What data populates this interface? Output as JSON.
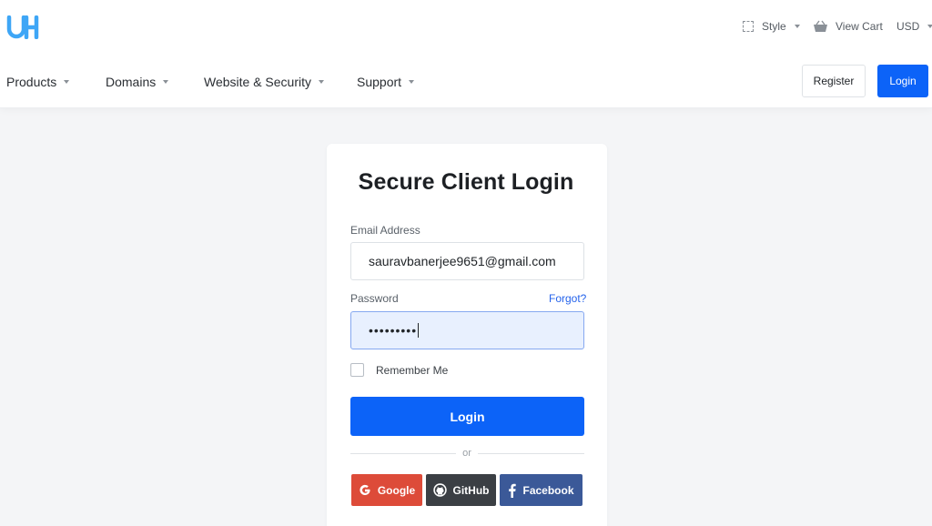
{
  "topbar": {
    "style_label": "Style",
    "cart_label": "View Cart",
    "currency_label": "USD"
  },
  "nav": {
    "items": [
      {
        "label": "Products"
      },
      {
        "label": "Domains"
      },
      {
        "label": "Website & Security"
      },
      {
        "label": "Support"
      }
    ],
    "register_label": "Register",
    "login_label": "Login"
  },
  "login_card": {
    "title": "Secure Client Login",
    "email_label": "Email Address",
    "email_value": "sauravbanerjee9651@gmail.com",
    "password_label": "Password",
    "forgot_label": "Forgot?",
    "password_mask": "•••••••••",
    "remember_label": "Remember Me",
    "submit_label": "Login",
    "or_label": "or",
    "social": {
      "google": "Google",
      "github": "GitHub",
      "facebook": "Facebook"
    }
  },
  "colors": {
    "primary": "#0c63f8",
    "google": "#dd4b39",
    "github": "#3b3f44",
    "facebook": "#3b5998",
    "logo_blue": "#3ea6f6"
  },
  "icons": {
    "logo": "uh-logo",
    "style": "style-box-icon",
    "cart": "basket-icon",
    "google": "google-icon",
    "github": "github-icon",
    "facebook": "facebook-icon"
  }
}
